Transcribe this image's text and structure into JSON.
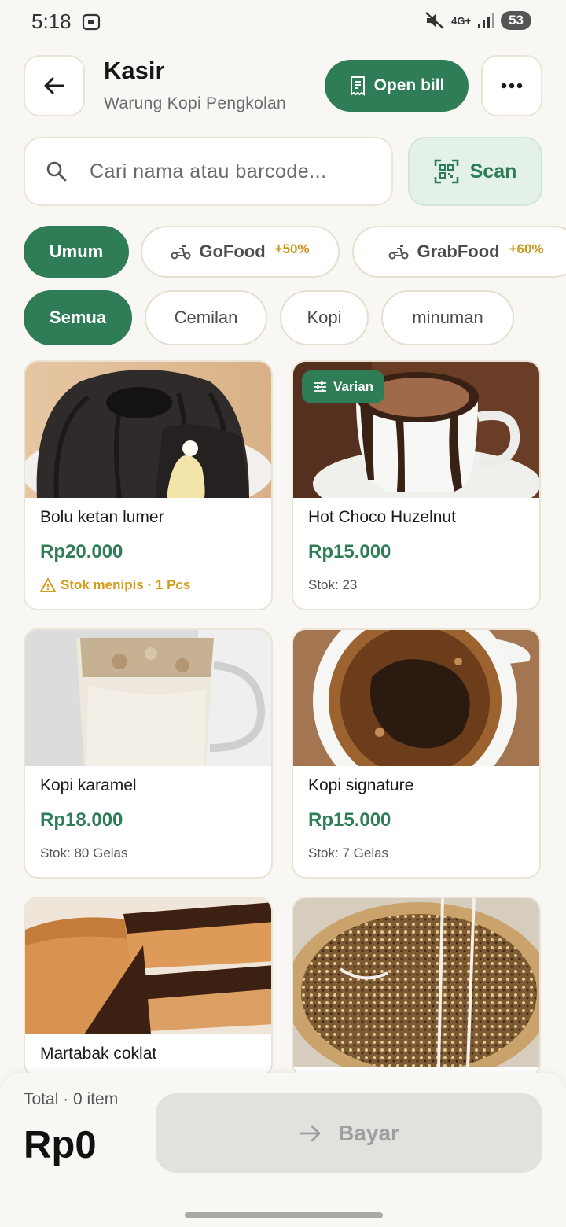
{
  "status": {
    "time": "5:18",
    "network": "4G+",
    "battery": "53"
  },
  "header": {
    "title": "Kasir",
    "subtitle": "Warung Kopi Pengkolan",
    "open_bill_label": "Open bill"
  },
  "search": {
    "placeholder": "Cari nama atau barcode...",
    "scan_label": "Scan"
  },
  "channels": [
    {
      "label": "Umum",
      "active": true
    },
    {
      "label": "GoFood",
      "badge": "+50%",
      "active": false
    },
    {
      "label": "GrabFood",
      "badge": "+60%",
      "active": false
    }
  ],
  "categories": [
    {
      "label": "Semua",
      "active": true
    },
    {
      "label": "Cemilan",
      "active": false
    },
    {
      "label": "Kopi",
      "active": false
    },
    {
      "label": "minuman",
      "active": false
    }
  ],
  "products": [
    {
      "name": "Bolu ketan lumer",
      "price": "Rp20.000",
      "stock": "Stok menipis · 1 Pcs",
      "low_stock": true
    },
    {
      "name": "Hot Choco Huzelnut",
      "price": "Rp15.000",
      "stock": "Stok: 23",
      "badge": "Varian"
    },
    {
      "name": "Kopi karamel",
      "price": "Rp18.000",
      "stock": "Stok: 80 Gelas"
    },
    {
      "name": "Kopi signature",
      "price": "Rp15.000",
      "stock": "Stok: 7 Gelas"
    },
    {
      "name": "Martabak coklat",
      "price": "",
      "stock": ""
    },
    {
      "name": "",
      "price": "",
      "stock": ""
    }
  ],
  "footer": {
    "total_label": "Total · 0 item",
    "total_value": "Rp0",
    "pay_label": "Bayar"
  },
  "colors": {
    "primary": "#2f7d57",
    "accent": "#c9951c",
    "background": "#f8f7f4"
  }
}
